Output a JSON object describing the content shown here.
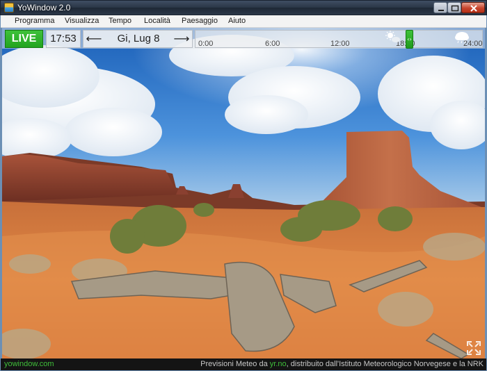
{
  "window": {
    "title": "YoWindow 2.0"
  },
  "menu": {
    "items": [
      "Programma",
      "Visualizza",
      "Tempo",
      "Località",
      "Paesaggio",
      "Aiuto"
    ]
  },
  "controls": {
    "live_label": "LIVE",
    "current_time": "17:53",
    "date_label": "Gi, Lug 8",
    "prev_arrow": "⟵",
    "next_arrow": "⟶"
  },
  "timeline": {
    "ticks": [
      "0:00",
      "6:00",
      "12:00",
      "18:00",
      "24:00"
    ],
    "position_fraction": 0.745
  },
  "status": {
    "site": "yowindow.com",
    "credits_prefix": "Previsioni Meteo da ",
    "credits_link": "yr.no",
    "credits_suffix": ", distribuito dall'Istituto Meteorologico Norvegese e la NRK"
  },
  "colors": {
    "live_green": "#22a41f",
    "link_green": "#3fbf3a",
    "sky_top": "#1a5fb8",
    "sand": "#d67a3e"
  },
  "icons": {
    "sun": "sun-icon",
    "cloud": "cloud-rain-icon",
    "fullscreen": "fullscreen-icon"
  }
}
